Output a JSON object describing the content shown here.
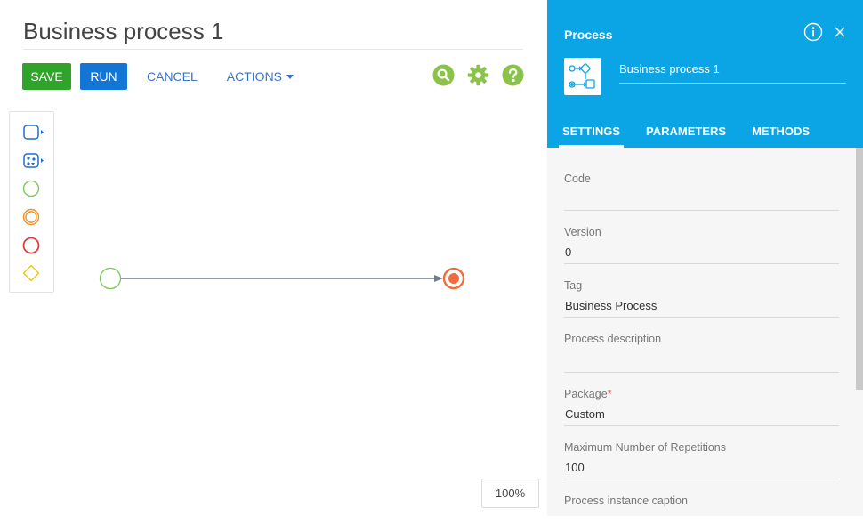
{
  "designer": {
    "title": "Business process 1",
    "toolbar": {
      "save_label": "SAVE",
      "run_label": "RUN",
      "cancel_label": "CANCEL",
      "actions_label": "ACTIONS"
    },
    "zoom_label": "100%"
  },
  "panel": {
    "title": "Process",
    "process_name": "Business process 1",
    "tabs": [
      {
        "label": "SETTINGS",
        "active": true
      },
      {
        "label": "PARAMETERS",
        "active": false
      },
      {
        "label": "METHODS",
        "active": false
      }
    ],
    "fields": [
      {
        "label": "Code",
        "value": ""
      },
      {
        "label": "Version",
        "value": "0"
      },
      {
        "label": "Tag",
        "value": "Business Process"
      },
      {
        "label": "Process description",
        "value": ""
      },
      {
        "label": "Package",
        "value": "Custom",
        "required": true
      },
      {
        "label": "Maximum Number of Repetitions",
        "value": "100"
      },
      {
        "label": "Process instance caption",
        "value": ""
      }
    ]
  },
  "colors": {
    "accent_blue": "#0ba5e5",
    "save_green": "#2fa32a",
    "run_blue": "#1376d5",
    "link_blue": "#3b73c8",
    "icon_green": "#8bc34a",
    "end_orange": "#f26b3a"
  }
}
